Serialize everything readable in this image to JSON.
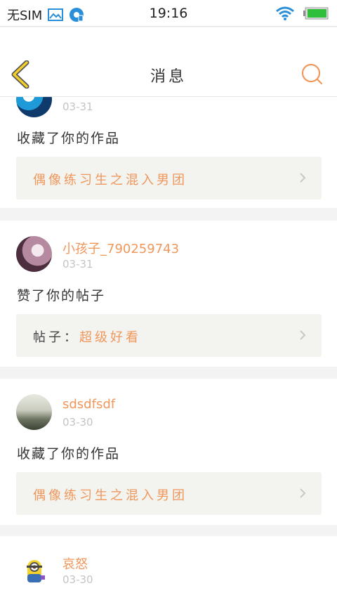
{
  "status_bar": {
    "carrier": "无SIM",
    "time": "19:16"
  },
  "nav": {
    "title": "消息"
  },
  "notifications": [
    {
      "username": "",
      "date": "03-31",
      "action": "收藏了你的作品",
      "ref_prefix": "",
      "ref_text": "偶像练习生之混入男团"
    },
    {
      "username": "小孩子_790259743",
      "date": "03-31",
      "action": "赞了你的帖子",
      "ref_prefix": "帖子：",
      "ref_text": "超级好看"
    },
    {
      "username": "sdsdfsdf",
      "date": "03-30",
      "action": "收藏了你的作品",
      "ref_prefix": "",
      "ref_text": "偶像练习生之混入男团"
    },
    {
      "username": "哀怒",
      "date": "03-30"
    }
  ],
  "colors": {
    "accent": "#f0975c",
    "back_icon": "#f2cf2a",
    "date": "#c4c4c4"
  }
}
